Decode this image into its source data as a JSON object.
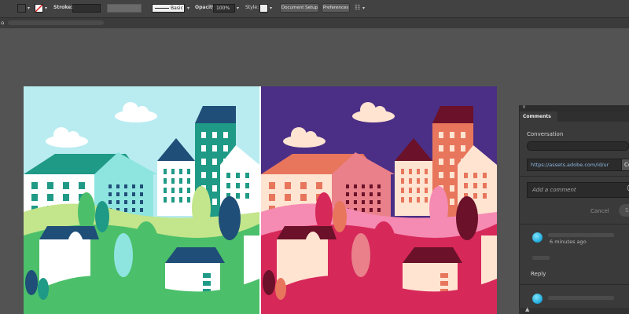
{
  "toolbar": {
    "stroke_label": "Stroke:",
    "stroke_weight_value": "",
    "brush_style_label": "Basic",
    "opacity_label": "Opacity:",
    "opacity_value": "100%",
    "style_label": "Style:",
    "document_setup_label": "Document Setup",
    "preferences_label": "Preferences",
    "fill_color": "#ffffff"
  },
  "artboard": {
    "left_scheme": {
      "sky": "#b9ecf1",
      "accent": "#1f9a86",
      "dark": "#1f4e78",
      "light": "#ffffff",
      "grass": "#4cbf6a",
      "pale_grass": "#c3e58b",
      "cyan": "#8ee5e0"
    },
    "right_scheme": {
      "sky": "#4b2f86",
      "accent": "#e8765c",
      "dark": "#6b1129",
      "light": "#ffe4d2",
      "grass": "#d7285a",
      "pale_grass": "#f58ab2",
      "cyan": "#e9808a"
    }
  },
  "comments_panel": {
    "tab_label": "Comments",
    "conversation_label": "Conversation",
    "link_url": "https://assets.adobe.com/id/ur",
    "copy_label": "Co",
    "comment_placeholder": "Add a comment",
    "cancel_label": "Cancel",
    "post_label": "S",
    "comment_time": "6 minutes ago",
    "reply_label": "Reply"
  }
}
